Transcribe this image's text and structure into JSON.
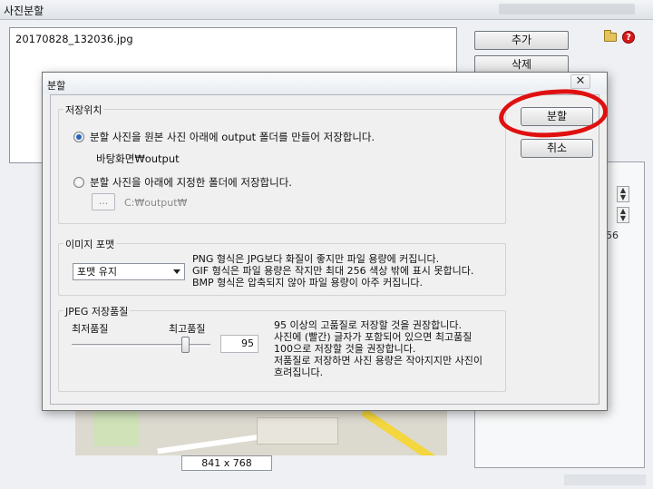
{
  "app": {
    "title": "사진분할",
    "file_list": [
      "20170828_132036.jpg"
    ],
    "buttons": {
      "add": "추가",
      "delete": "삭제"
    },
    "preview_size": "841 x 768",
    "side_value": "56"
  },
  "dialog": {
    "title": "분할",
    "close_glyph": "✕",
    "save_location": {
      "group_label": "저장위치",
      "option_original": "분할 사진을 원본 사진 아래에 output 폴더를 만들어 저장합니다.",
      "original_path": "바탕화면₩output",
      "option_custom": "분할 사진을 아래에 지정한 폴더에 저장합니다.",
      "browse_label": "...",
      "custom_path": "C:₩output₩",
      "selected": "original"
    },
    "image_format": {
      "group_label": "이미지 포맷",
      "selected": "포맷 유지",
      "description": [
        "PNG 형식은 JPG보다 화질이 좋지만 파일 용량에 커집니다.",
        "GIF 형식은 파일 용량은 작지만 최대 256 색상 밖에 표시 못합니다.",
        "BMP 형식은 압축되지 않아 파일 용량이 아주 커집니다."
      ]
    },
    "jpeg_quality": {
      "group_label": "JPEG 저장품질",
      "min_label": "최저품질",
      "max_label": "최고품질",
      "value": "95",
      "slider_fraction": 0.82,
      "description": [
        "95 이상의 고품질로 저장할 것을 권장합니다.",
        "사진에 (빨간) 글자가 포함되어 있으면 최고품질",
        "100으로 저장할 것을 권장합니다.",
        "저품질로 저장하면 사진 용량은 작아지지만 사진이",
        "흐려집니다."
      ]
    },
    "buttons": {
      "split": "분할",
      "cancel": "취소"
    },
    "highlight_color": "#e01010"
  }
}
